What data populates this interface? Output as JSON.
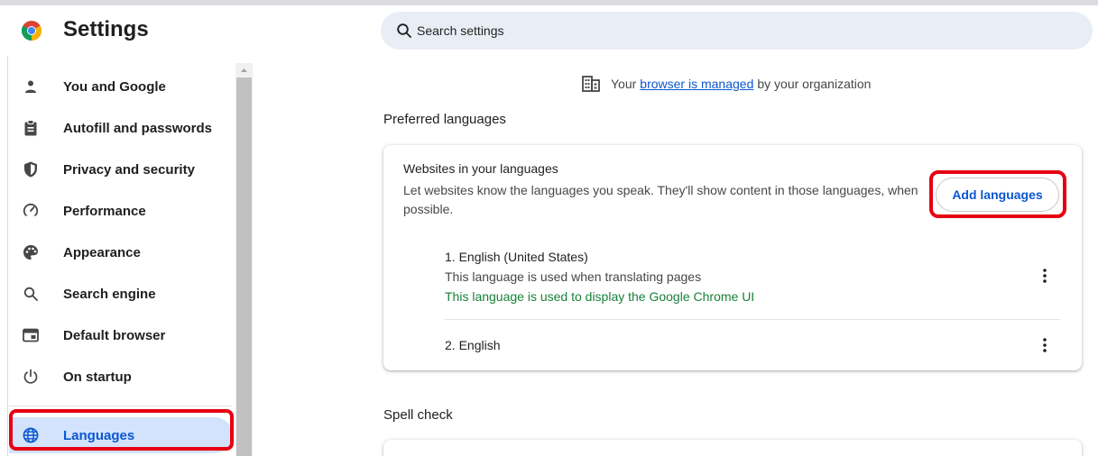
{
  "app": {
    "title": "Settings"
  },
  "search": {
    "placeholder": "Search settings"
  },
  "sidebar": {
    "items": [
      {
        "label": "You and Google",
        "icon": "person-icon"
      },
      {
        "label": "Autofill and passwords",
        "icon": "clipboard-icon"
      },
      {
        "label": "Privacy and security",
        "icon": "shield-icon"
      },
      {
        "label": "Performance",
        "icon": "speedometer-icon"
      },
      {
        "label": "Appearance",
        "icon": "palette-icon"
      },
      {
        "label": "Search engine",
        "icon": "search-icon"
      },
      {
        "label": "Default browser",
        "icon": "browser-window-icon"
      },
      {
        "label": "On startup",
        "icon": "power-icon"
      },
      {
        "label": "Languages",
        "icon": "globe-icon",
        "active": true
      }
    ]
  },
  "managed": {
    "prefix": "Your",
    "link": "browser is managed",
    "suffix": "by your organization"
  },
  "preferred": {
    "section_title": "Preferred languages",
    "heading": "Websites in your languages",
    "description": "Let websites know the languages you speak. They'll show content in those languages, when possible.",
    "add_button": "Add languages",
    "languages": [
      {
        "name": "1. English (United States)",
        "translate_note": "This language is used when translating pages",
        "ui_note": "This language is used to display the Google Chrome UI"
      },
      {
        "name": "2. English"
      }
    ]
  },
  "spell_check": {
    "section_title": "Spell check"
  },
  "colors": {
    "accent": "#0b57d0",
    "highlight": "#e60012",
    "ui_note": "#188038",
    "active_bg": "#d3e3fd"
  }
}
